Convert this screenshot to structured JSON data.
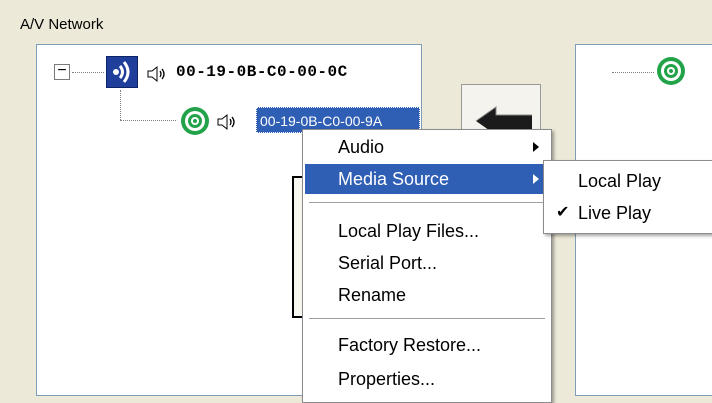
{
  "group": {
    "label": "A/V Network"
  },
  "tree": {
    "expander_symbol": "−",
    "root_node": {
      "label": "00-19-0B-C0-00-0C"
    },
    "child_node": {
      "label": "00-19-0B-C0-00-9A"
    }
  },
  "context_menu": {
    "items": [
      {
        "label": "Audio",
        "submenu": true
      },
      {
        "label": "Media Source",
        "submenu": true,
        "highlighted": true
      },
      {
        "label": "Local Play Files..."
      },
      {
        "label": "Serial Port..."
      },
      {
        "label": "Rename"
      },
      {
        "label": "Factory Restore..."
      },
      {
        "label": "Properties..."
      }
    ]
  },
  "submenu": {
    "items": [
      {
        "label": "Local Play",
        "checked": false
      },
      {
        "label": "Live Play",
        "checked": true,
        "check_glyph": "✔"
      }
    ]
  },
  "colors": {
    "selection": "#2f5eb5",
    "window_bg": "#ece9d8",
    "device_icon": "#1f3f9a",
    "target_icon": "#22a34a"
  }
}
